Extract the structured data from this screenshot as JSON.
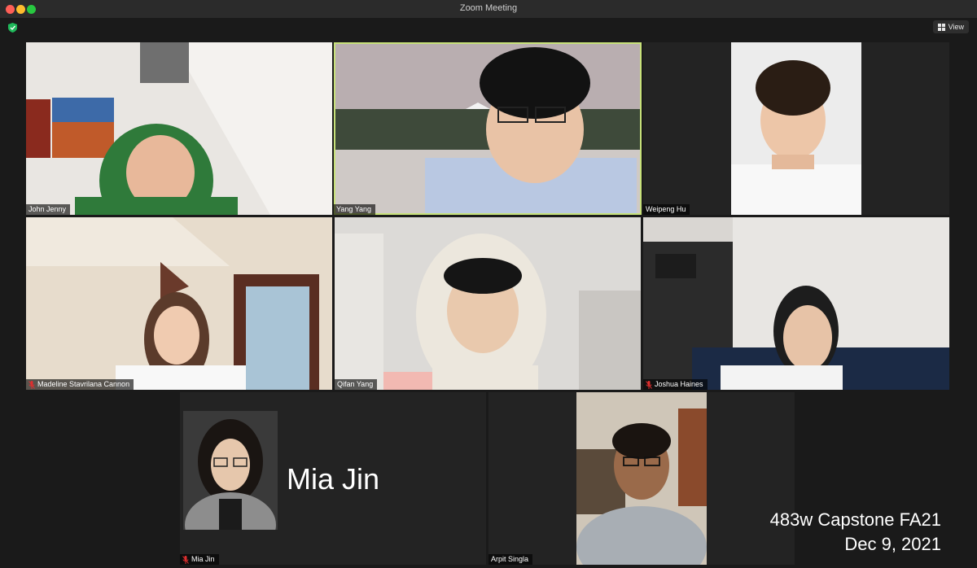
{
  "window": {
    "title": "Zoom Meeting",
    "view_label": "View"
  },
  "participants": [
    {
      "name": "John Jenny",
      "muted": false,
      "active": false,
      "video": "on"
    },
    {
      "name": "Yang Yang",
      "muted": false,
      "active": true,
      "video": "on"
    },
    {
      "name": "Weipeng Hu",
      "muted": false,
      "active": false,
      "video": "on"
    },
    {
      "name": "Madeline Stavrilana Cannon",
      "muted": true,
      "active": false,
      "video": "on"
    },
    {
      "name": "Qifan Yang",
      "muted": false,
      "active": false,
      "video": "on"
    },
    {
      "name": "Joshua Haines",
      "muted": true,
      "active": false,
      "video": "on"
    },
    {
      "name": "Mia Jin",
      "muted": true,
      "active": false,
      "video": "off",
      "display_name": "Mia Jin"
    },
    {
      "name": "Arpit Singla",
      "muted": false,
      "active": false,
      "video": "on"
    }
  ],
  "overlay": {
    "line1": "483w Capstone FA21",
    "line2": "Dec 9, 2021"
  },
  "colors": {
    "active_border": "#c8e27a",
    "mute_red": "#e02f2f",
    "shield_green": "#1fb85a"
  }
}
